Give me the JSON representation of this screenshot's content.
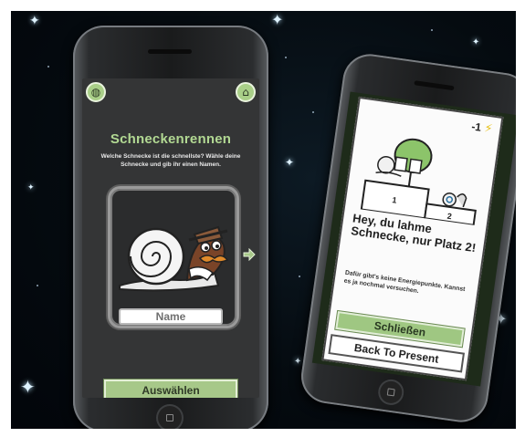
{
  "left_screen": {
    "title": "Schneckenrennen",
    "description": "Welche Schnecke ist die schnellste? Wähle deine Schnecke und gib ihr einen Namen.",
    "name_field_value": "Name",
    "select_button_label": "Auswählen",
    "icons": {
      "top_left": "globe-icon",
      "top_right": "home-icon",
      "next": "arrow-right-icon"
    }
  },
  "right_screen": {
    "energy_value": "-1",
    "energy_icon": "lightning-bolt-icon",
    "podium_places": [
      "1",
      "2"
    ],
    "headline": "Hey, du lahme Schnecke, nur Platz 2!",
    "subtext": "Dafür gibt's keine Energiepunkte. Kannst es ja nochmal versuchen.",
    "close_button_label": "Schließen",
    "back_button_label": "Back To Present"
  },
  "colors": {
    "accent_green": "#a7c889",
    "title_green": "#b2d993",
    "screen_dark": "#343536",
    "energy_yellow": "#e8c21c"
  }
}
